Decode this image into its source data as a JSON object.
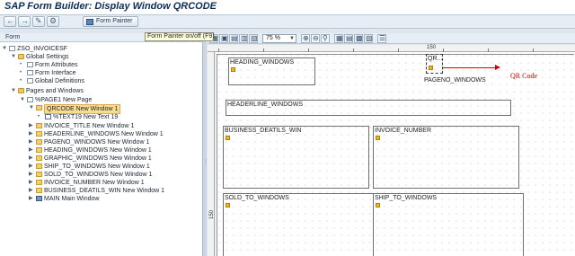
{
  "window": {
    "title": "SAP Form Builder: Display Window QRCODE"
  },
  "toolbar": {
    "form_painter_label": "Form Painter",
    "back_icon": "back-arrow-icon",
    "forward_icon": "forward-arrow-icon"
  },
  "tooltip": "Form Painter on/off   (F9)",
  "left_panel": {
    "header": "Form",
    "tree": [
      {
        "label": "ZSO_INVOICESF",
        "icon": "doc-icon"
      },
      {
        "label": "Global Settings",
        "icon": "folder-icon"
      },
      {
        "label": "Form Attributes",
        "icon": "doc-icon"
      },
      {
        "label": "Form Interface",
        "icon": "doc-icon"
      },
      {
        "label": "Global Definitions",
        "icon": "doc-icon"
      },
      {
        "label": "Pages and Windows",
        "icon": "folder-icon"
      },
      {
        "label": "%PAGE1 New Page",
        "icon": "page-icon"
      },
      {
        "label": "QRCODE New Window 1",
        "icon": "window-icon",
        "selected": true
      },
      {
        "label": "%TEXT19 New Text 19",
        "icon": "text-icon"
      },
      {
        "label": "INVOICE_TITLE New Window 1",
        "icon": "window-icon"
      },
      {
        "label": "HEADERLINE_WINDOWS New Window 1",
        "icon": "window-icon"
      },
      {
        "label": "PAGENO_WINDOWS New Window 1",
        "icon": "window-icon"
      },
      {
        "label": "HEADING_WINDOWS New Window 1",
        "icon": "window-icon"
      },
      {
        "label": "GRAPHIC_WINDOWS New Window 1",
        "icon": "window-icon"
      },
      {
        "label": "SHIP_TO_WINDOWS New Window 1",
        "icon": "window-icon"
      },
      {
        "label": "SOLD_TO_WINDOWS New Window 1",
        "icon": "window-icon"
      },
      {
        "label": "INVOICE_NUMBER New Window 1",
        "icon": "window-icon"
      },
      {
        "label": "BUSINESS_DEATILS_WIN New Window 1",
        "icon": "window-icon"
      },
      {
        "label": "MAIN Main Window",
        "icon": "main-window-icon"
      }
    ]
  },
  "painter": {
    "zoom": "75 %",
    "ruler_top_label": "150",
    "ruler_left_label": "150",
    "windows": [
      {
        "name": "HEADING_WINDOWS"
      },
      {
        "name": "QR..."
      },
      {
        "name": "PAGENO_WINDOWS"
      },
      {
        "name": "HEADERLINE_WINDOWS"
      },
      {
        "name": "BUSINESS_DEATILS_WIN"
      },
      {
        "name": "INVOICE_NUMBER"
      },
      {
        "name": "SOLD_TO_WINDOWS"
      },
      {
        "name": "SHIP_TO_WINDOWS"
      }
    ],
    "annotation": "QR Code",
    "annotation_color": "#d40000"
  }
}
